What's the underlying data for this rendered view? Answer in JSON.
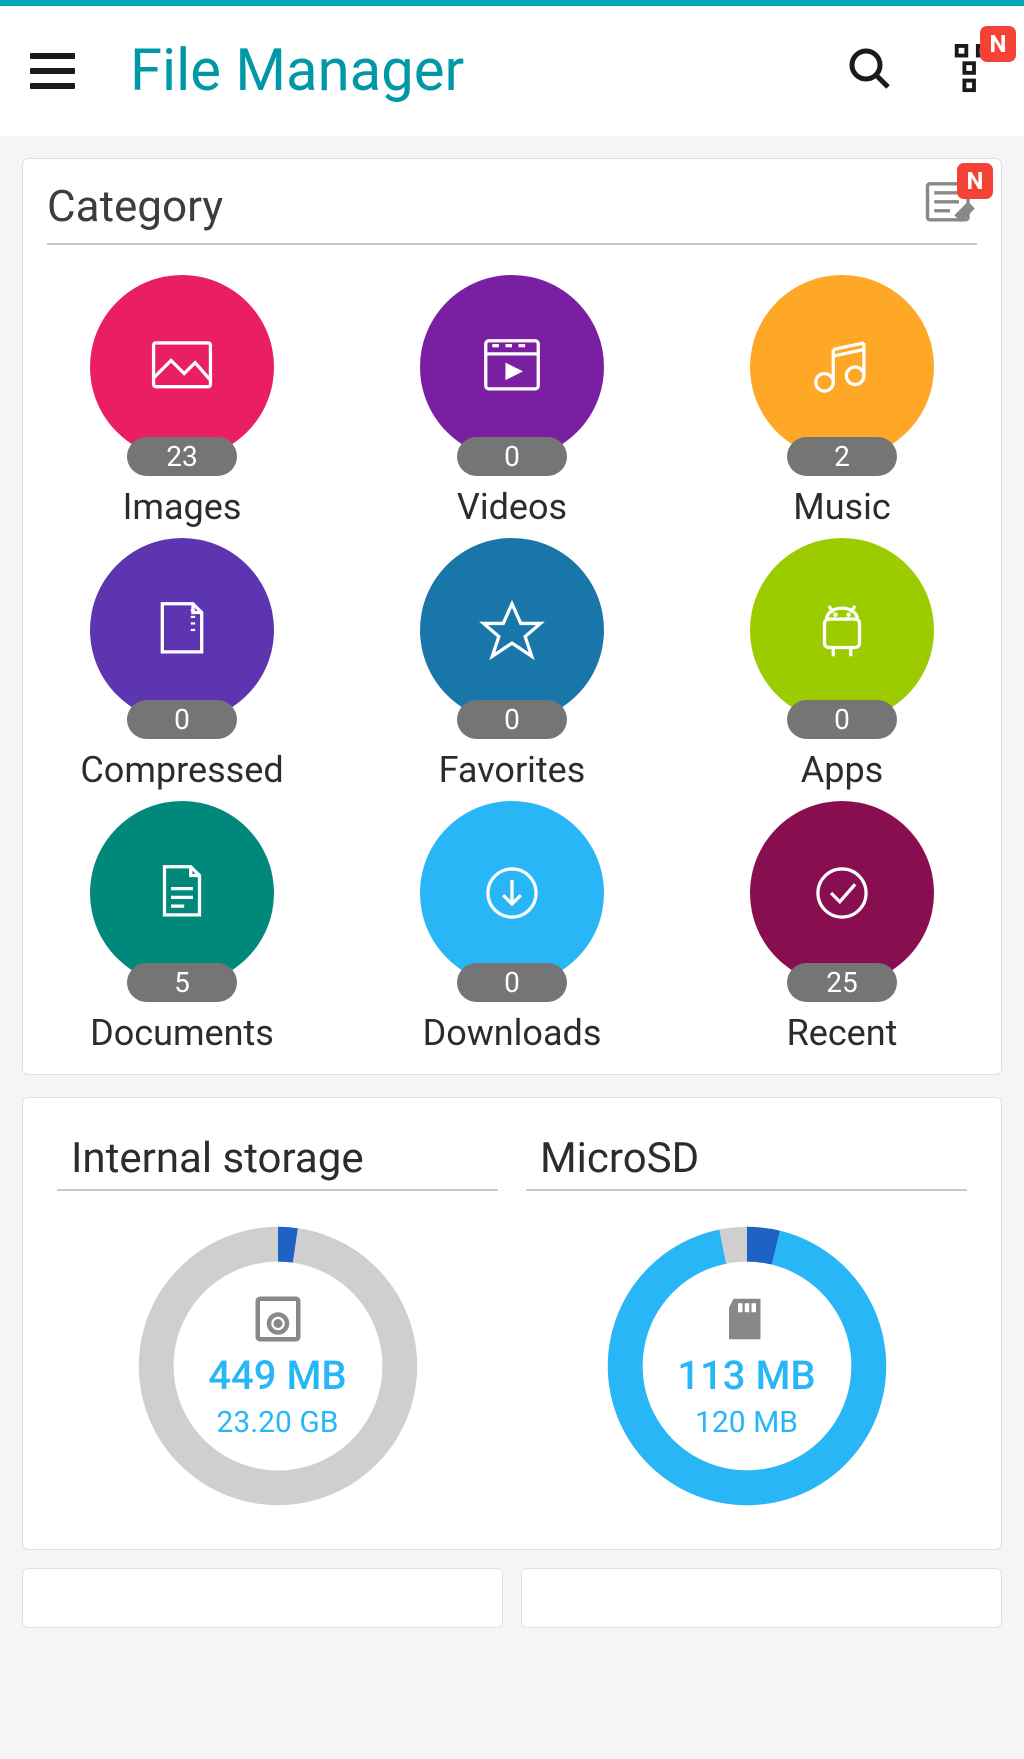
{
  "header": {
    "title": "File Manager",
    "notif": "N"
  },
  "category": {
    "title": "Category",
    "edit_notif": "N",
    "items": [
      {
        "label": "Images",
        "count": "23",
        "color": "#e91e63",
        "icon": "image"
      },
      {
        "label": "Videos",
        "count": "0",
        "color": "#7b1fa2",
        "icon": "video"
      },
      {
        "label": "Music",
        "count": "2",
        "color": "#ffa726",
        "icon": "music"
      },
      {
        "label": "Compressed",
        "count": "0",
        "color": "#5e35b1",
        "icon": "zip"
      },
      {
        "label": "Favorites",
        "count": "0",
        "color": "#1976a8",
        "icon": "star"
      },
      {
        "label": "Apps",
        "count": "0",
        "color": "#9ccc00",
        "icon": "android"
      },
      {
        "label": "Documents",
        "count": "5",
        "color": "#00897b",
        "icon": "doc"
      },
      {
        "label": "Downloads",
        "count": "0",
        "color": "#29b6f6",
        "icon": "download"
      },
      {
        "label": "Recent",
        "count": "25",
        "color": "#880e4f",
        "icon": "check"
      }
    ]
  },
  "storage": {
    "internal": {
      "title": "Internal storage",
      "used": "449 MB",
      "total": "23.20 GB",
      "pct": 2
    },
    "microsd": {
      "title": "MicroSD",
      "used": "113 MB",
      "total": "120 MB",
      "pct": 94
    }
  }
}
